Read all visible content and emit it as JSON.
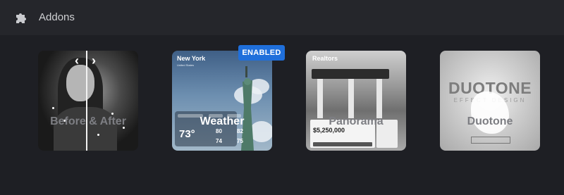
{
  "header": {
    "title": "Addons",
    "icon": "puzzle-icon"
  },
  "addons": [
    {
      "label": "Before & After",
      "enabled": false,
      "preview": {
        "prev_arrow": "‹",
        "next_arrow": "›"
      }
    },
    {
      "label": "Weather",
      "enabled": true,
      "badge": "ENABLED",
      "preview": {
        "city": "New York",
        "country": "United States",
        "temp": "73°",
        "high_1": "80",
        "low_1": "74",
        "high_2": "82",
        "low_2": "75"
      }
    },
    {
      "label": "Panorama",
      "enabled": false,
      "preview": {
        "brand": "Realtors",
        "price": "$5,250,000"
      }
    },
    {
      "label": "Duotone",
      "enabled": false,
      "preview": {
        "title": "DUOTONE",
        "subtitle": "EFFECT DESIGN"
      }
    }
  ],
  "colors": {
    "badge": "#1f6fdb",
    "background": "#1e1f24",
    "header": "#25262b"
  }
}
